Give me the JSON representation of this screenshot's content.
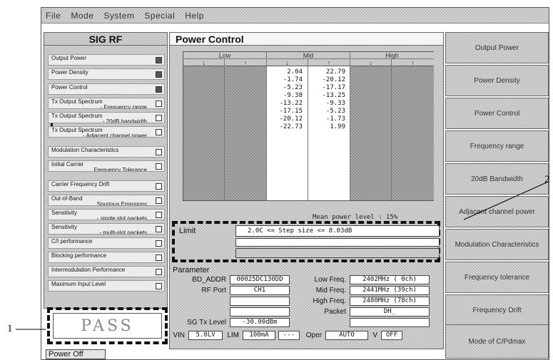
{
  "menu": [
    "File",
    "Mode",
    "System",
    "Special",
    "Help"
  ],
  "left_panel": {
    "title": "SIG RF",
    "items": [
      {
        "label": "Output Power",
        "sub": "",
        "checked": true
      },
      {
        "label": "Power Density",
        "sub": "",
        "checked": true
      },
      {
        "label": "Power Control",
        "sub": "",
        "checked": true
      },
      {
        "label": "Tx Output Spectrum",
        "sub": "- Frequency range",
        "checked": false
      },
      {
        "label": "Tx Output Spectrum",
        "sub": "- 20dB bandwidth",
        "checked": false
      },
      {
        "label": "Tx Output Spectrum",
        "sub": "- Adjacent channel power",
        "checked": false
      },
      {
        "label": "Modulation Characteristics",
        "sub": "",
        "checked": false
      },
      {
        "label": "Initial Carrier",
        "sub": "Frequency Tolerance",
        "checked": false
      },
      {
        "label": "Carrier Frequency Drift",
        "sub": "",
        "checked": false
      },
      {
        "label": "Out-of-Band",
        "sub": "Spurious Emissions",
        "checked": false
      },
      {
        "label": "Sensitivity",
        "sub": "- single slot packets",
        "checked": false
      },
      {
        "label": "Sensitivity",
        "sub": "- multi-slot packets",
        "checked": false
      },
      {
        "label": "C/I performance",
        "sub": "",
        "checked": false
      },
      {
        "label": "Blocking performance",
        "sub": "",
        "checked": false
      },
      {
        "label": "Intermodulation Performance",
        "sub": "",
        "checked": false
      },
      {
        "label": "Maximum Input Level",
        "sub": "",
        "checked": false
      }
    ]
  },
  "pass_label": "PASS",
  "power_off_label": "Power Off",
  "main_panel": {
    "title": "Power Control",
    "groups": [
      "Low",
      "Mid",
      "High"
    ],
    "sub_headers": [
      "↓",
      "↑",
      "↓",
      "↑",
      "↓",
      "↑"
    ],
    "mid_down_values": [
      "2.04",
      "-1.74",
      "-5.23",
      "-9.38",
      "-13.22",
      "-17.15",
      "-20.12",
      "-22.73"
    ],
    "mid_up_values": [
      "22.79",
      "-20.12",
      "-17.17",
      "-13.25",
      "-9.33",
      "-5.23",
      "-1.73",
      "1.99"
    ],
    "mean_power": "Mean power level : 15%",
    "limit_label": "Limit",
    "limit_value": "2.0C <= Step size <= 8.03dB",
    "param_title": "Parameter",
    "bd_addr_label": "BD_ADDR",
    "bd_addr_value": "00025DC130DD",
    "rf_port_label": "RF Port",
    "rf_port_value": "CH1",
    "low_freq_label": "Low Freq.",
    "low_freq_value": "2402MHz  ( 0ch)",
    "mid_freq_label": "Mid Freq.",
    "mid_freq_value": "2441MHz (39ch)",
    "high_freq_label": "High Freq.",
    "high_freq_value": "2480MHz (78ch)",
    "packet_label": "Packet",
    "packet_value": "DH_",
    "sg_tx_level_label": "SG Tx Level",
    "sg_tx_level_value": "-30.00dBm",
    "vin_label": "VIN",
    "vin_value": "5.0LV",
    "lim_label": "LIM",
    "lim_value": "100mA",
    "dash_label": "---",
    "oper_label": "Oper",
    "oper_value": "AUTO",
    "v_label": "V",
    "v_value": "OFF"
  },
  "right_buttons": [
    "Output Power",
    "Power Density",
    "Power Control",
    "Frequency range",
    "20dB Bandwidth",
    "Adjacent channel power",
    "Modulation Characteristics",
    "Frequency tolerance",
    "Frequency Drift",
    "Mode of C/Pdmax"
  ],
  "callouts": [
    "1",
    "2"
  ]
}
